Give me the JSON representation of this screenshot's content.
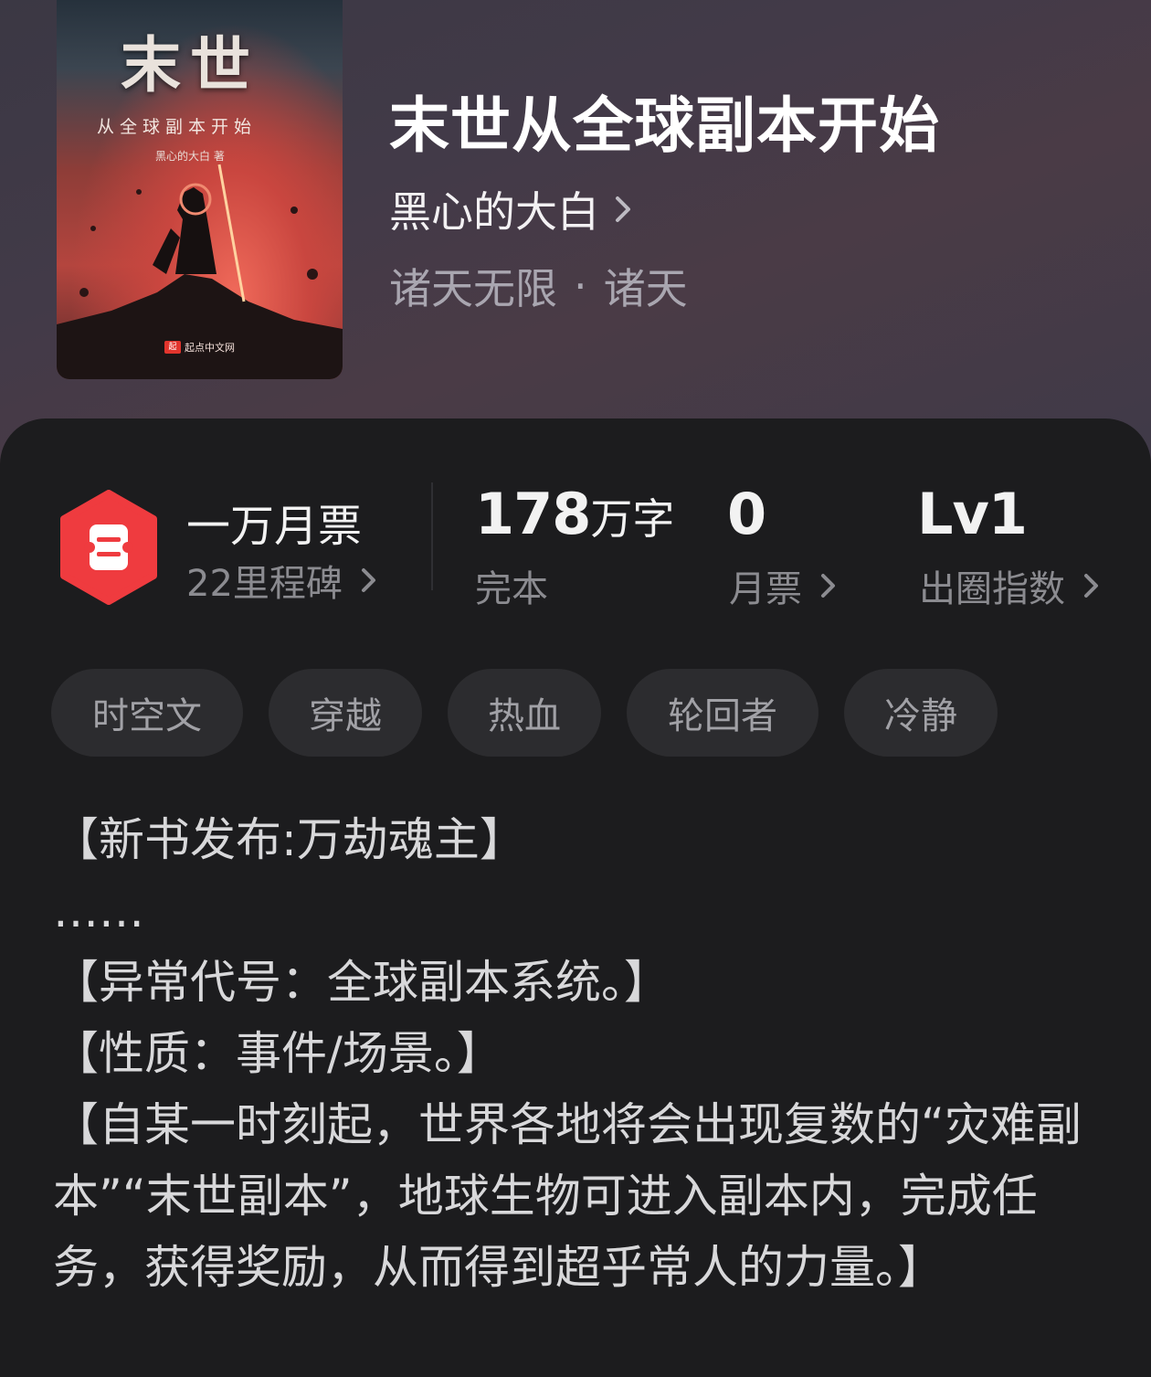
{
  "book": {
    "cover": {
      "title": "末世",
      "subtitle": "从全球副本开始",
      "author": "黑心的大白 著",
      "publisher": "起点中文网",
      "publisher_logo": "起"
    },
    "title": "末世从全球副本开始",
    "author": "黑心的大白",
    "genre": "诸天无限",
    "subgenre": "诸天",
    "genre_separator": "·"
  },
  "stats": {
    "tickets_title": "一万月票",
    "milestones": "22里程碑",
    "word_count": "178",
    "word_unit": "万字",
    "status": "完本",
    "monthly_votes": "0",
    "monthly_votes_label": "月票",
    "level": "Lv1",
    "level_label": "出圈指数"
  },
  "tags": [
    "时空文",
    "穿越",
    "热血",
    "轮回者",
    "冷静"
  ],
  "description": [
    "【新书发布:万劫魂主】",
    "……",
    "【异常代号：全球副本系统。】",
    "【性质：事件/场景。】",
    "【自某一时刻起，世界各地将会出现复数的“灾难副本”“末世副本”，地球生物可进入副本内，完成任务，获得奖励，从而得到超乎常人的力量。】"
  ],
  "colors": {
    "badge_red": "#ef3b3f",
    "panel_bg": "#1c1c1e",
    "tag_bg": "#2c2c2f"
  }
}
